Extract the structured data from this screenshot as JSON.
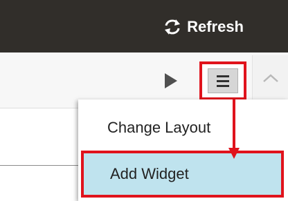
{
  "header": {
    "refresh_label": "Refresh",
    "refresh_icon": "refresh-icon",
    "background": "#312e2a"
  },
  "toolbar": {
    "play_icon": "play-icon",
    "menu_icon": "hamburger-menu-icon",
    "scroll_icon": "chevron-up-icon"
  },
  "dropdown": {
    "items": [
      {
        "label": "Change Layout",
        "highlighted": false
      },
      {
        "label": "Add Widget",
        "highlighted": true
      }
    ]
  },
  "annotation": {
    "highlight_color": "#e0131c",
    "selected_item_bg": "#bfe3ee"
  }
}
